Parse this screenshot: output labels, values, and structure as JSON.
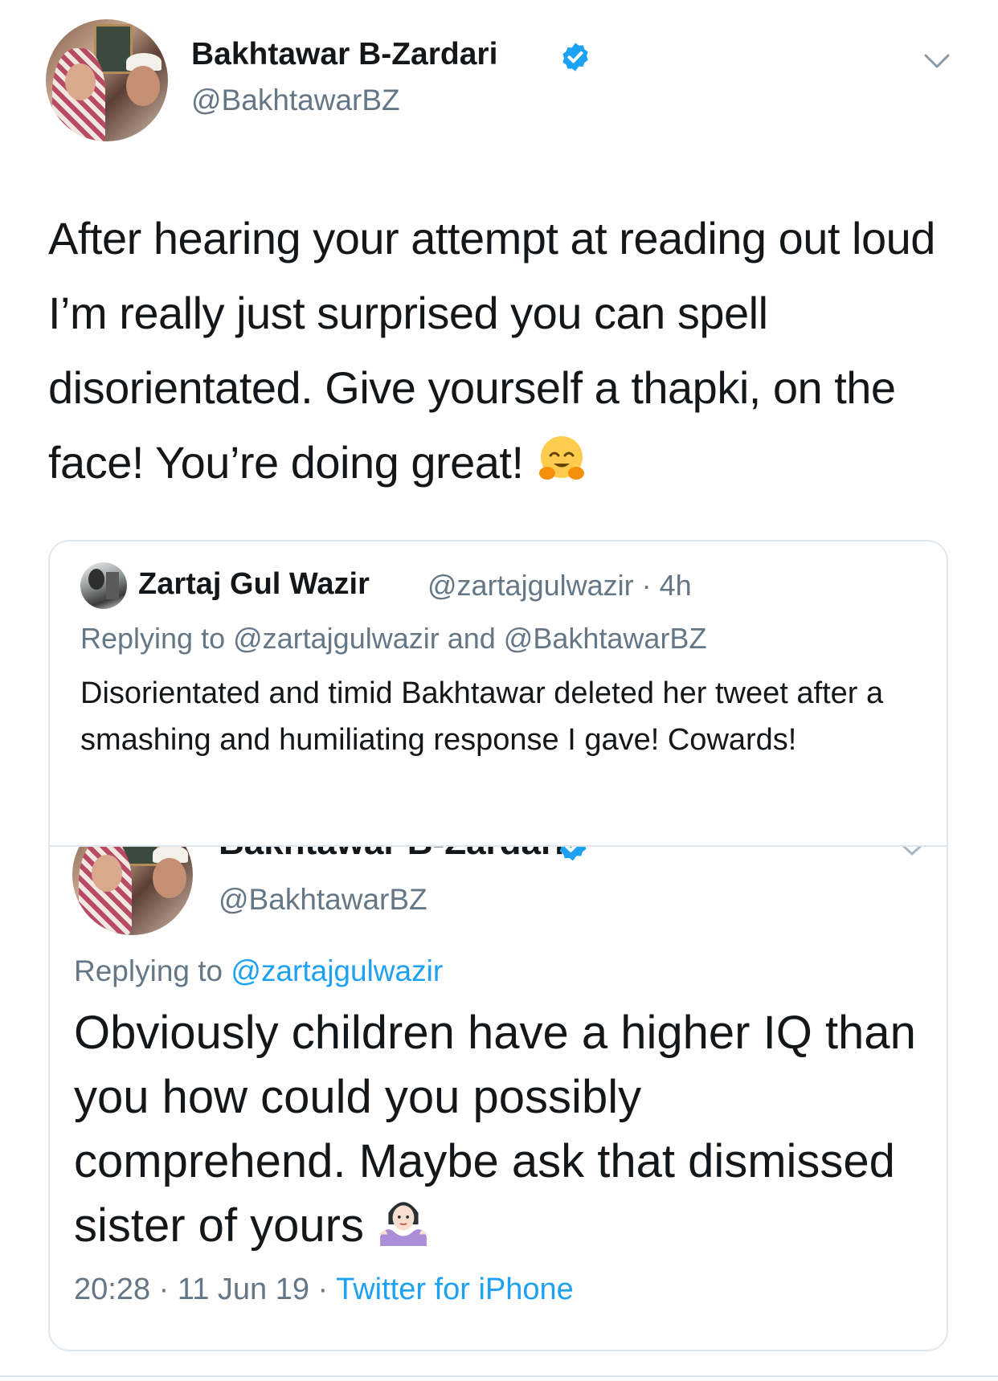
{
  "tweet": {
    "author_name": "Bakhtawar B-Zardari",
    "author_handle": "@BakhtawarBZ",
    "verified": true,
    "text": "After hearing your attempt at reading out loud I’m really just surprised you can spell disorientated. Give yourself a thapki, on the face! You’re doing great!",
    "text_emoji": "hugging-face-emoji"
  },
  "quoted_tweet": {
    "author_name": "Zartaj Gul Wazir",
    "author_handle": "@zartajgulwazir",
    "separator": "·",
    "time": "4h",
    "replying_to": "Replying to @zartajgulwazir and @BakhtawarBZ",
    "text": "Disorientated and timid Bakhtawar deleted her tweet after a smashing and humiliating response I gave! Cowards!",
    "embedded_tweet": {
      "author_name": "Bakhtawar B-Zardari",
      "author_handle": "@BakhtawarBZ",
      "verified": true,
      "replying_label": "Replying to",
      "replying_mention": "@zartajgulwazir",
      "text": "Obviously children have a higher IQ than you how could you possibly comprehend. Maybe ask that dismissed sister of yours",
      "text_emoji": "person-shrugging-emoji",
      "time": "20:28",
      "date": "11 Jun 19",
      "separator": "·",
      "source": "Twitter for iPhone"
    }
  },
  "colors": {
    "text": "#14171a",
    "secondary": "#657786",
    "link": "#1da1f2",
    "border": "#e1e8ed",
    "verified": "#1da1f2"
  }
}
